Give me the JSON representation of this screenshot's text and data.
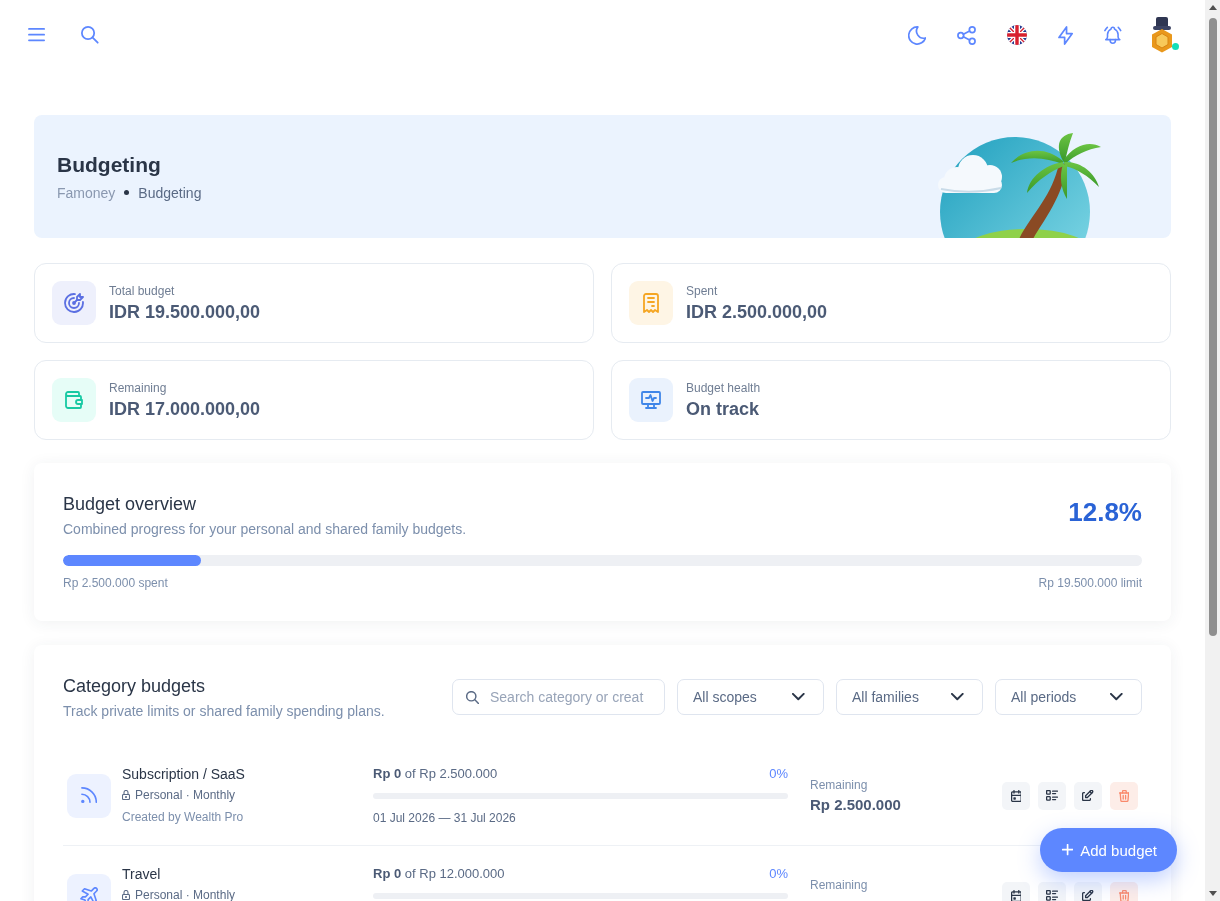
{
  "topbar": {
    "user": {
      "online": true
    }
  },
  "header": {
    "title": "Budgeting",
    "breadcrumb": [
      {
        "label": "Famoney",
        "current": false
      },
      {
        "label": "Budgeting",
        "current": true
      }
    ]
  },
  "stats": [
    {
      "kind": "target",
      "label": "Total budget",
      "value": "IDR 19.500.000,00"
    },
    {
      "kind": "receipt",
      "label": "Spent",
      "value": "IDR 2.500.000,00"
    },
    {
      "kind": "wallet",
      "label": "Remaining",
      "value": "IDR 17.000.000,00"
    },
    {
      "kind": "monitor",
      "label": "Budget health",
      "value": "On track"
    }
  ],
  "overview": {
    "title": "Budget overview",
    "subtitle": "Combined progress for your personal and shared family budgets.",
    "percent": "12.8%",
    "level": 0.128,
    "spent": "Rp 2.500.000 spent",
    "limit": "Rp 19.500.000 limit"
  },
  "categories": {
    "title": "Category budgets",
    "subtitle": "Track private limits or shared family spending plans.",
    "filters": [
      {
        "kind": "search",
        "placeholder": "Search category or creat"
      },
      {
        "kind": "select",
        "value": "All scopes"
      },
      {
        "kind": "select",
        "value": "All families"
      },
      {
        "kind": "select",
        "value": "All periods"
      }
    ],
    "rows": [
      {
        "kind": "subscription",
        "name": "Subscription / SaaS",
        "private": true,
        "scope": "Personal · Monthly",
        "creator": "Created by Wealth Pro",
        "amount": "**Rp 0** of Rp 2.500.000",
        "percent": "0%",
        "level": 0,
        "period": "01 Jul 2026 — 31 Jul 2026",
        "remaining_label": "Remaining",
        "remaining": "Rp 2.500.000"
      },
      {
        "kind": "travel",
        "name": "Travel",
        "private": true,
        "scope": "Personal · Monthly",
        "amount": "**Rp 0** of Rp 12.000.000",
        "percent": "0%",
        "level": 0,
        "remaining_label": "Remaining"
      }
    ]
  },
  "add_button": {
    "label": "Add budget"
  }
}
